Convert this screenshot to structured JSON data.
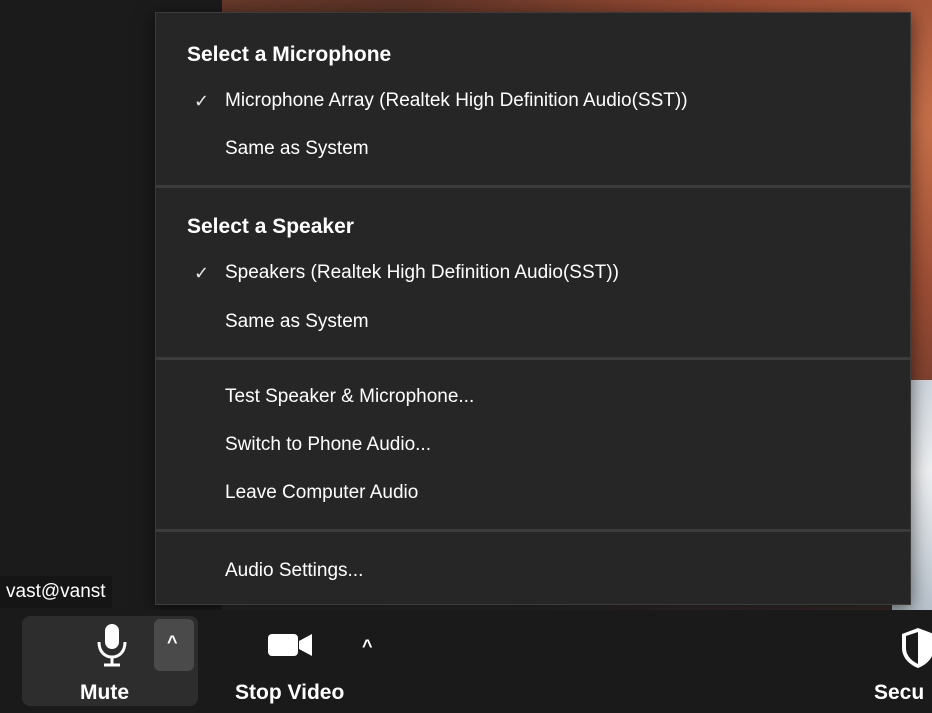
{
  "participant": {
    "name": "vast@vanst"
  },
  "audio_menu": {
    "microphone_section": {
      "heading": "Select a Microphone",
      "items": [
        {
          "label": "Microphone Array (Realtek High Definition Audio(SST))",
          "checked": true,
          "check_glyph": "✓"
        },
        {
          "label": "Same as System",
          "checked": false
        }
      ]
    },
    "speaker_section": {
      "heading": "Select a Speaker",
      "items": [
        {
          "label": "Speakers (Realtek High Definition Audio(SST))",
          "checked": true,
          "check_glyph": "✓"
        },
        {
          "label": "Same as System",
          "checked": false
        }
      ]
    },
    "actions": [
      {
        "label": "Test Speaker & Microphone..."
      },
      {
        "label": "Switch to Phone Audio..."
      },
      {
        "label": "Leave Computer Audio"
      }
    ],
    "settings": {
      "label": "Audio Settings..."
    }
  },
  "toolbar": {
    "mute_label": "Mute",
    "stop_video_label": "Stop Video",
    "security_label": "Secu",
    "caret_glyph": "^"
  },
  "colors": {
    "menu_bg": "#262626",
    "divider": "#3b3b3b",
    "toolbar_bg": "#1a1a1a",
    "mute_group_bg": "#2d2d2d",
    "caret_button_bg": "#4a4a4a"
  },
  "icons": [
    "microphone-icon",
    "video-camera-icon",
    "shield-icon",
    "chevron-up-icon",
    "checkmark-icon"
  ]
}
